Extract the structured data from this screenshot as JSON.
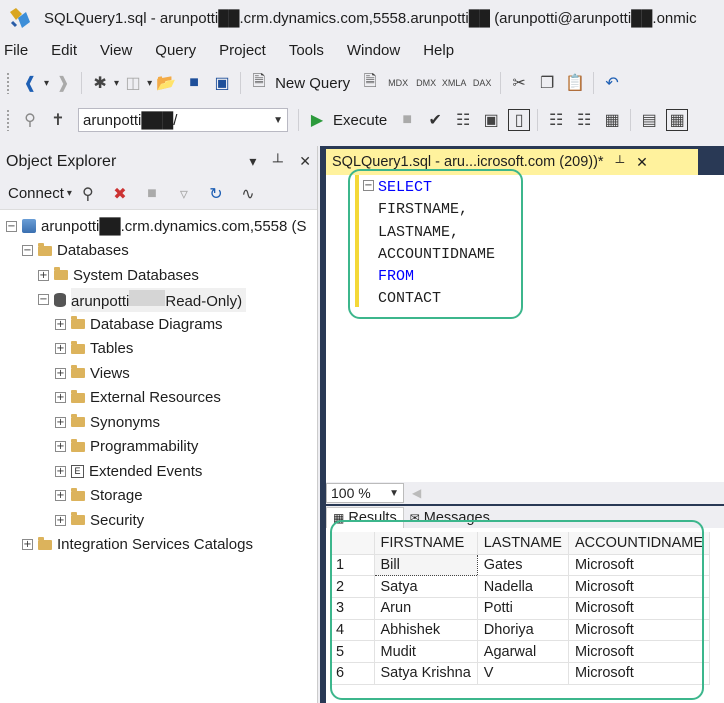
{
  "window": {
    "title": "SQLQuery1.sql - arunpotti██.crm.dynamics.com,5558.arunpotti██ (arunpotti@arunpotti██.onmic"
  },
  "menu": [
    "File",
    "Edit",
    "View",
    "Query",
    "Project",
    "Tools",
    "Window",
    "Help"
  ],
  "toolbar": {
    "new_query": "New Query",
    "database": "arunpotti███/",
    "execute": "Execute",
    "icon_labels": [
      "MDX",
      "DMX",
      "XMLA",
      "DAX"
    ]
  },
  "object_explorer": {
    "title": "Object Explorer",
    "connect": "Connect",
    "server": "arunpotti██.crm.dynamics.com,5558 (S",
    "databases": "Databases",
    "system_databases": "System Databases",
    "db_name_prefix": "arunpotti",
    "db_name_suffix": "Read-Only)",
    "children": [
      "Database Diagrams",
      "Tables",
      "Views",
      "External Resources",
      "Synonyms",
      "Programmability",
      "Extended Events",
      "Storage",
      "Security"
    ],
    "integration": "Integration Services Catalogs"
  },
  "editor": {
    "tab_title": "SQLQuery1.sql - aru...icrosoft.com (209))*",
    "lines": [
      {
        "text": "SELECT",
        "kw": true
      },
      {
        "text": "FIRSTNAME,",
        "kw": false
      },
      {
        "text": "LASTNAME,",
        "kw": false
      },
      {
        "text": "ACCOUNTIDNAME",
        "kw": false
      },
      {
        "text": "FROM",
        "kw": true
      },
      {
        "text": "CONTACT",
        "kw": false
      }
    ],
    "zoom": "100 %"
  },
  "results": {
    "tabs": [
      "Results",
      "Messages"
    ],
    "columns": [
      "FIRSTNAME",
      "LASTNAME",
      "ACCOUNTIDNAME"
    ],
    "rows": [
      [
        "1",
        "Bill",
        "Gates",
        "Microsoft"
      ],
      [
        "2",
        "Satya",
        "Nadella",
        "Microsoft"
      ],
      [
        "3",
        "Arun",
        "Potti",
        "Microsoft"
      ],
      [
        "4",
        "Abhishek",
        "Dhoriya",
        "Microsoft"
      ],
      [
        "5",
        "Mudit",
        "Agarwal",
        "Microsoft"
      ],
      [
        "6",
        "Satya Krishna",
        "V",
        "Microsoft"
      ]
    ]
  },
  "colors": {
    "highlight_box": "#3cb68c",
    "tab_active": "#fff29d",
    "keyword": "#0000ff"
  }
}
